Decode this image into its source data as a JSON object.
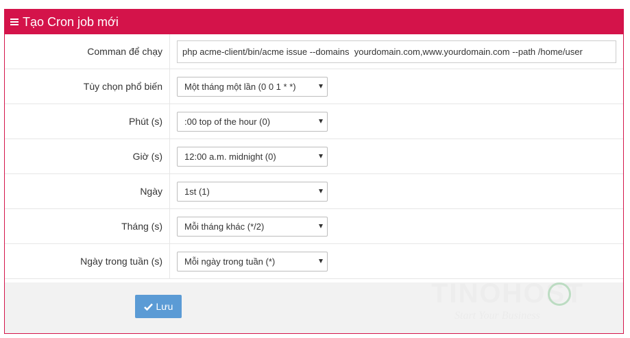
{
  "header": {
    "title": "Tạo Cron job mới",
    "icon": "menu-icon"
  },
  "form": {
    "command": {
      "label": "Comman để chạy",
      "value": "php acme-client/bin/acme issue --domains  yourdomain.com,www.yourdomain.com --path /home/user"
    },
    "preset": {
      "label": "Tùy chọn phổ biến",
      "selected": "Một tháng một lần (0 0 1 * *)"
    },
    "minute": {
      "label": "Phút (s)",
      "selected": ":00 top of the hour (0)"
    },
    "hour": {
      "label": "Giờ (s)",
      "selected": "12:00 a.m. midnight (0)"
    },
    "day": {
      "label": "Ngày",
      "selected": "1st (1)"
    },
    "month": {
      "label": "Tháng (s)",
      "selected": "Mỗi tháng khác (*/2)"
    },
    "weekday": {
      "label": "Ngày trong tuần (s)",
      "selected": "Mỗi ngày trong tuần (*)"
    }
  },
  "footer": {
    "save_label": "Lưu"
  },
  "watermark": {
    "brand": "TINOHOST",
    "tagline": "Start Your Business"
  },
  "colors": {
    "header_bg": "#d4134a",
    "button_bg": "#5b9bd5",
    "footer_bg": "#f2f2f2"
  }
}
